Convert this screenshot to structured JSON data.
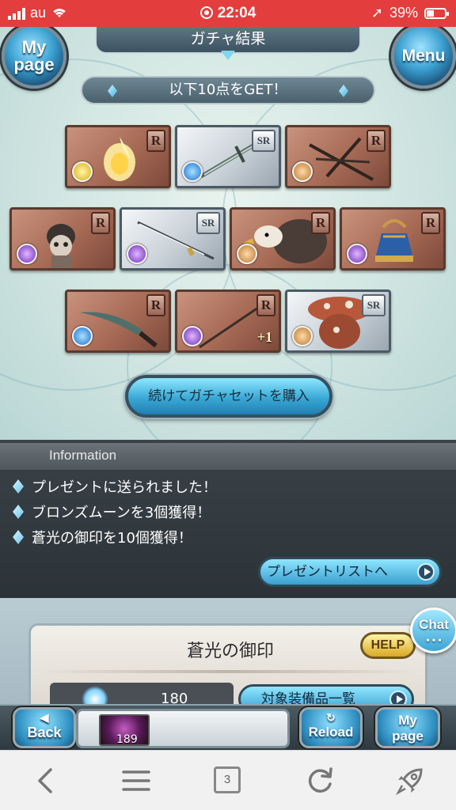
{
  "status_bar": {
    "carrier": "au",
    "time": "22:04",
    "battery": "39%",
    "battery_level": 0.39
  },
  "header": {
    "title": "ガチャ結果",
    "left_button": "My page",
    "right_button": "Menu"
  },
  "result_banner": "以下10点をGET！",
  "items": [
    {
      "rarity": "R",
      "element": "light",
      "icon": "flame-spirit-icon",
      "plus": ""
    },
    {
      "rarity": "SR",
      "element": "water",
      "icon": "sword-icon",
      "plus": ""
    },
    {
      "rarity": "R",
      "element": "earth",
      "icon": "crossed-staves-icon",
      "plus": ""
    },
    {
      "rarity": "R",
      "element": "dark",
      "icon": "skeleton-knight-icon",
      "plus": ""
    },
    {
      "rarity": "SR",
      "element": "dark",
      "icon": "katana-icon",
      "plus": ""
    },
    {
      "rarity": "R",
      "element": "earth",
      "icon": "griffin-icon",
      "plus": ""
    },
    {
      "rarity": "R",
      "element": "dark",
      "icon": "bell-icon",
      "plus": ""
    },
    {
      "rarity": "R",
      "element": "water",
      "icon": "dagger-icon",
      "plus": ""
    },
    {
      "rarity": "R",
      "element": "dark",
      "icon": "spear-icon",
      "plus": "+1"
    },
    {
      "rarity": "SR",
      "element": "earth",
      "icon": "mushroom-golem-icon",
      "plus": ""
    }
  ],
  "buy_button": "続けてガチャセットを購入",
  "information": {
    "title": "Information",
    "lines": [
      "プレゼントに送られました！",
      "ブロンズムーンを3個獲得！",
      "蒼光の御印を10個獲得！"
    ],
    "present_button": "プレゼントリストへ"
  },
  "seal": {
    "name": "蒼光の御印",
    "help": "HELP",
    "count": "180",
    "equip_button": "対象装備品一覧"
  },
  "chat_button": "Chat",
  "bottom_bar": {
    "back": "Back",
    "reload": "Reload",
    "mypage": "My page",
    "moon_count": "189"
  },
  "browser": {
    "tab_count": "3"
  }
}
